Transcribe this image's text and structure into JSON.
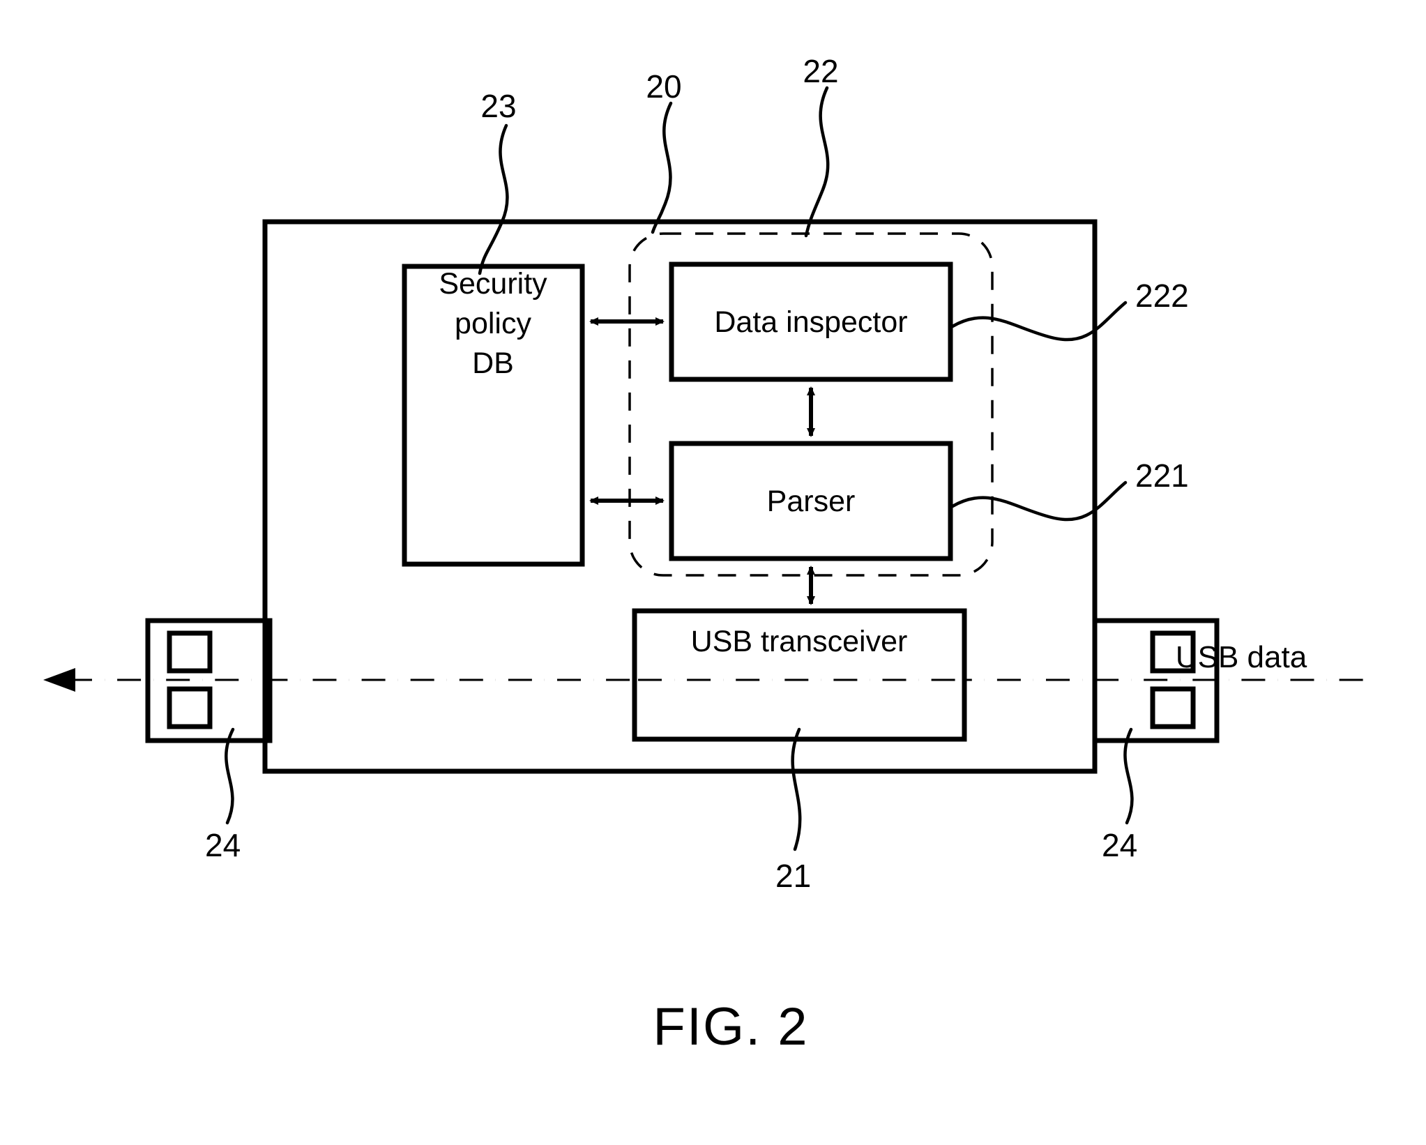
{
  "figure": {
    "caption": "FIG. 2",
    "blocks": {
      "security_policy_db": "Security\npolicy\nDB",
      "security_policy_db_lines": [
        "Security",
        "policy",
        "DB"
      ],
      "data_inspector": "Data inspector",
      "parser": "Parser",
      "usb_transceiver": "USB transceiver"
    },
    "side_labels": {
      "usb_data": "USB data"
    },
    "reference_numerals": {
      "device": "20",
      "usb_transceiver": "21",
      "security_module": "22",
      "security_policy_db": "23",
      "usb_connector_left": "24",
      "usb_connector_right": "24",
      "parser": "221",
      "data_inspector": "222"
    },
    "colors": {
      "stroke": "#000000",
      "background": "#ffffff"
    }
  }
}
